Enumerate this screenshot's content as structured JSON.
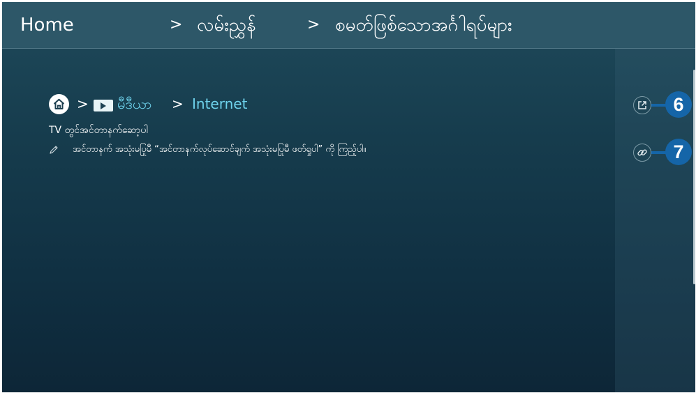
{
  "header": {
    "home_label": "Home",
    "sep": ">",
    "level1_label": "လမ်းညွှန်",
    "level2_label": "စမတ်ဖြစ်သောအင်္ဂါရပ်များ"
  },
  "path": {
    "sep": ">",
    "media_label": "မီဒီယာ",
    "internet_label": "Internet"
  },
  "content": {
    "title": "TV တွင်အင်တာနက်ဆော့ပါ",
    "note": "အင်တာနက် အသုံးမပြုမီ “အင်တာနက်လုပ်ဆောင်ချက် အသုံးမပြုမီ ဖတ်ရှုပါ” ကို ကြည့်ပါ။"
  },
  "actions": [
    {
      "icon": "open-external-icon",
      "number": "6"
    },
    {
      "icon": "link-icon",
      "number": "7"
    }
  ],
  "colors": {
    "header_bg": "#2d5768",
    "accent_text": "#6ed2ec",
    "badge": "#1565a8"
  }
}
